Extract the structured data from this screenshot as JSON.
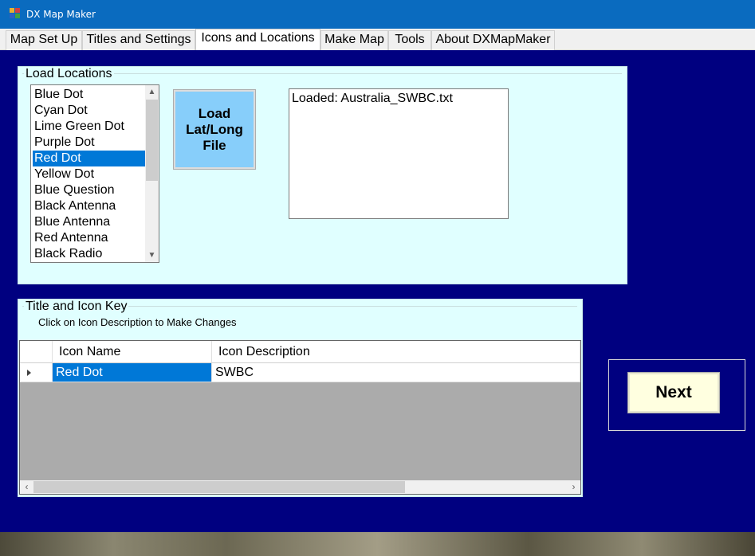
{
  "window": {
    "title": "DX Map Maker",
    "icon": "app-grid-icon"
  },
  "tabs": [
    {
      "label": "Map Set Up"
    },
    {
      "label": "Titles and Settings"
    },
    {
      "label": "Icons and Locations",
      "active": true
    },
    {
      "label": "Make Map"
    },
    {
      "label": "Tools"
    },
    {
      "label": "About DXMapMaker"
    }
  ],
  "load_locations": {
    "title": "Load Locations",
    "icons": [
      "Blue Dot",
      "Cyan Dot",
      "Lime Green Dot",
      "Purple Dot",
      "Red Dot",
      "Yellow Dot",
      "Blue Question",
      "Black Antenna",
      "Blue Antenna",
      "Red Antenna",
      "Black Radio"
    ],
    "selected_icon": "Red Dot",
    "load_button": "Load\nLat/Long\nFile",
    "status_text": "Loaded: Australia_SWBC.txt"
  },
  "icon_key": {
    "title": "Title and Icon Key",
    "hint": "Click on Icon Description to Make Changes",
    "columns": [
      "Icon Name",
      "Icon Description"
    ],
    "rows": [
      {
        "icon_name": "Red Dot",
        "icon_description": "SWBC"
      }
    ]
  },
  "next_button": "Next",
  "colors": {
    "window_bg": "#000080",
    "panel_bg": "#e0ffff",
    "titlebar": "#0a6bbf",
    "selection": "#0078d7",
    "load_button": "#87cefa",
    "next_button": "#ffffe0"
  }
}
